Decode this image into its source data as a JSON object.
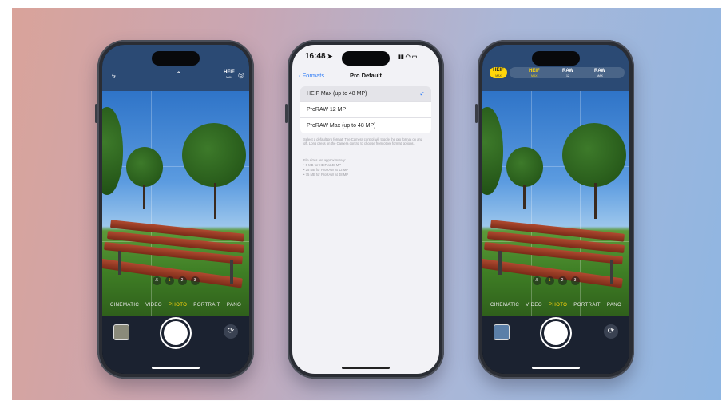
{
  "phones": {
    "left": {
      "modes": [
        "CINEMATIC",
        "VIDEO",
        "PHOTO",
        "PORTRAIT",
        "PANO"
      ],
      "active_mode": "PHOTO",
      "format_label": "HEIF",
      "format_sub": "MAX",
      "zoom_levels": [
        ".5",
        "1",
        "2",
        "3"
      ]
    },
    "middle": {
      "time": "16:48",
      "back_label": "Formats",
      "title": "Pro Default",
      "options": [
        {
          "label": "HEIF Max (up to 48 MP)",
          "selected": true
        },
        {
          "label": "ProRAW 12 MP",
          "selected": false
        },
        {
          "label": "ProRAW Max (up to 48 MP)",
          "selected": false
        }
      ],
      "check_glyph": "✓",
      "footer_description": "Select a default pro format. The Camera control will toggle the pro format on and off. Long press on the Camera control to choose from other format options.",
      "footer_sizes_title": "File sizes are approximately:",
      "footer_sizes": [
        "• 5 MB for HEIF at 48 MP",
        "• 25 MB for ProRAW at 12 MP",
        "• 75 MB for ProRAW at 48 MP"
      ]
    },
    "right": {
      "pill_label": "HEIF",
      "pill_sub": "MAX",
      "format_options": [
        {
          "label": "HEIF",
          "sub": "MAX"
        },
        {
          "label": "RAW",
          "sub": "12"
        },
        {
          "label": "RAW",
          "sub": "MAX"
        }
      ],
      "modes": [
        "CINEMATIC",
        "VIDEO",
        "PHOTO",
        "PORTRAIT",
        "PANO"
      ],
      "active_mode": "PHOTO",
      "zoom_levels": [
        ".5",
        "1",
        "2",
        "3"
      ]
    }
  },
  "colors": {
    "accent_yellow": "#ffd60a",
    "ios_blue": "#2f7cf6"
  }
}
